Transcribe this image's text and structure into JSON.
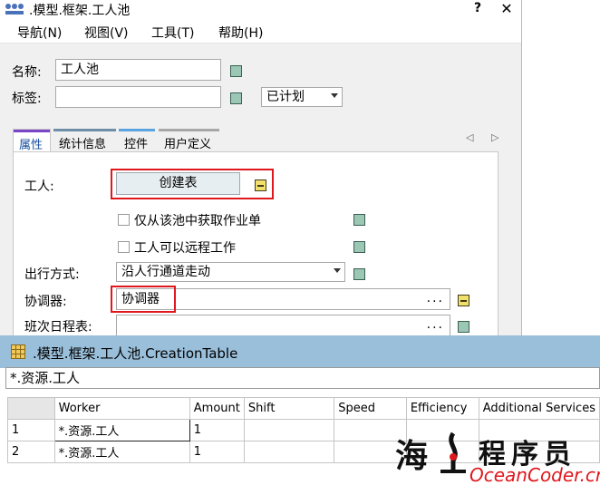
{
  "dialog": {
    "title": ".模型.框架.工人池",
    "help_label": "?",
    "close_label": "✕"
  },
  "menu": [
    "导航(N)",
    "视图(V)",
    "工具(T)",
    "帮助(H)"
  ],
  "fields": {
    "name_label": "名称:",
    "name_value": "工人池",
    "tag_label": "标签:",
    "tag_value": "",
    "tag_status": "已计划"
  },
  "tabs": [
    {
      "label": "属性",
      "color": "#7b45c8"
    },
    {
      "label": "统计信息",
      "color": "#6f8ea8"
    },
    {
      "label": "控件",
      "color": "#5aa3e0"
    },
    {
      "label": "用户定义",
      "color": "#a8a8a8"
    }
  ],
  "tab_nav": "◁ ▷",
  "properties": {
    "worker_label": "工人:",
    "create_table_button": "创建表",
    "only_from_pool_label": "仅从该池中获取作业单",
    "remote_work_label": "工人可以远程工作",
    "travel_label": "出行方式:",
    "travel_value": "沿人行通道走动",
    "coordinator_label": "协调器:",
    "coordinator_value": "协调器",
    "coordinator_ellipsis": "...",
    "shift_label": "班次日程表:",
    "shift_ellipsis": "..."
  },
  "creation_table": {
    "title": ".模型.框架.工人池.CreationTable",
    "path": "*.资源.工人",
    "columns": [
      "Worker",
      "Amount",
      "Shift",
      "Speed",
      "Efficiency",
      "Additional Services"
    ],
    "rows": [
      {
        "num": "1",
        "cells": [
          "*.资源.工人",
          "1",
          "",
          "",
          "",
          ""
        ]
      },
      {
        "num": "2",
        "cells": [
          "*.资源.工人",
          "1",
          "",
          "",
          "",
          ""
        ]
      }
    ]
  },
  "watermark": {
    "hai": "海",
    "brand": "程序员",
    "url": "OceanCoder.cn"
  },
  "colors": {
    "accent_red": "#e0171c",
    "table_title_bar": "#9abfda",
    "status_green": "#9cc7b4",
    "status_yellow": "#f2e06d"
  }
}
